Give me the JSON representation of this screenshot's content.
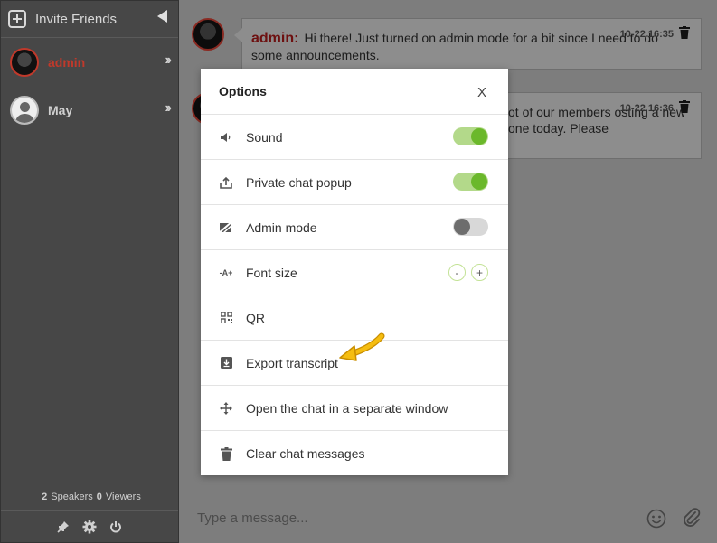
{
  "sidebar": {
    "invite_label": "Invite Friends",
    "users": [
      {
        "name": "admin"
      },
      {
        "name": "May"
      }
    ],
    "stats": {
      "speakers_count": "2",
      "speakers_label": "Speakers",
      "viewers_count": "0",
      "viewers_label": "Viewers"
    }
  },
  "messages": [
    {
      "author": "admin:",
      "text": "Hi there! Just turned on admin mode for a bit since I need to do some announcements.",
      "time": "10-22 16:35"
    },
    {
      "text": "ot of our members osting a new one today. Please",
      "time": "10-22 16:36"
    }
  ],
  "composer": {
    "placeholder": "Type a message..."
  },
  "options": {
    "title": "Options",
    "close": "X",
    "items": [
      {
        "label": "Sound",
        "control": "toggle",
        "state": "on"
      },
      {
        "label": "Private chat popup",
        "control": "toggle",
        "state": "on"
      },
      {
        "label": "Admin mode",
        "control": "toggle",
        "state": "off"
      },
      {
        "label": "Font size",
        "control": "stepper",
        "minus": "-",
        "plus": "+"
      },
      {
        "label": "QR"
      },
      {
        "label": "Export transcript"
      },
      {
        "label": "Open the chat in a separate window"
      },
      {
        "label": "Clear chat messages"
      }
    ]
  },
  "colors": {
    "toggle_on": "#6bb82b",
    "admin_name": "#c0392b",
    "arrow": "#f0b400"
  }
}
